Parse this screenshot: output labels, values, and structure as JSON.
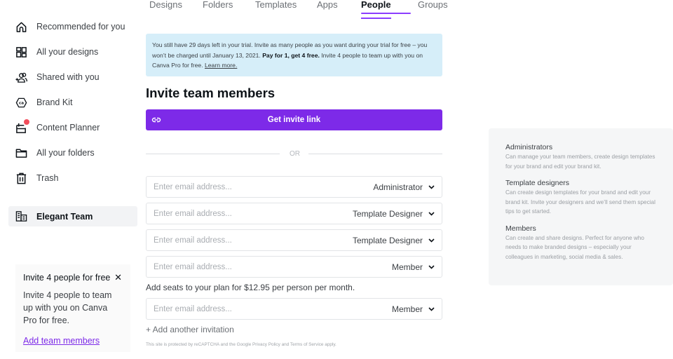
{
  "tabs": [
    {
      "label": "Designs",
      "active": false
    },
    {
      "label": "Folders",
      "active": false
    },
    {
      "label": "Templates",
      "active": false
    },
    {
      "label": "Apps",
      "active": false
    },
    {
      "label": "People",
      "active": true
    },
    {
      "label": "Groups",
      "active": false
    }
  ],
  "sidebar": {
    "items": [
      {
        "label": "Recommended for you",
        "icon": "home-icon"
      },
      {
        "label": "All your designs",
        "icon": "grid-icon"
      },
      {
        "label": "Shared with you",
        "icon": "shared-users-icon"
      },
      {
        "label": "Brand Kit",
        "icon": "brand-kit-icon"
      },
      {
        "label": "Content Planner",
        "icon": "calendar-icon",
        "notification": true
      },
      {
        "label": "All your folders",
        "icon": "folder-icon"
      },
      {
        "label": "Trash",
        "icon": "trash-icon"
      }
    ],
    "team": {
      "label": "Elegant Team",
      "icon": "team-building-icon"
    },
    "promo": {
      "title": "Invite 4 people for free",
      "close_icon": "close-icon",
      "body": "Invite 4 people to team up with you on Canva Pro for free.",
      "link": "Add team members"
    }
  },
  "trial_banner": {
    "text_before": "You still have 29 days left in your trial. Invite as many people as you want during your trial for free – you won’t be charged until January 13, 2021. ",
    "bold": "Pay for 1, get 4 free.",
    "text_after": " Invite 4 people to team up with you on Canva Pro for free. ",
    "link": "Learn more."
  },
  "invite": {
    "heading": "Invite team members",
    "invite_link_button": "Get invite link",
    "or_label": "OR",
    "email_placeholder": "Enter email address...",
    "rows": [
      {
        "value": "",
        "role": "Administrator"
      },
      {
        "value": "",
        "role": "Template Designer"
      },
      {
        "value": "",
        "role": "Template Designer"
      },
      {
        "value": "",
        "role": "Member"
      }
    ],
    "seats_text": "Add seats to your plan for $12.95 per person per month.",
    "extra_rows": [
      {
        "value": "",
        "role": "Member"
      }
    ],
    "add_another": "+ Add another invitation",
    "recaptcha": "This site is protected by reCAPTCHA and the Google Privacy Policy and Terms of Service apply."
  },
  "roles_info": [
    {
      "title": "Administrators",
      "desc": "Can manage your team members, create design templates for your brand and edit your brand kit."
    },
    {
      "title": "Template designers",
      "desc": "Can create design templates for your brand and edit your brand kit. Invite your designers and we’ll send them special tips to get started."
    },
    {
      "title": "Members",
      "desc": "Can create and share designs. Perfect for anyone who needs to make branded designs – especially your colleagues in marketing, social media & sales."
    }
  ],
  "colors": {
    "accent": "#7d2ae8",
    "tab_underline": "#8b3dff",
    "trial_banner_bg": "#d6eef9",
    "notification_dot": "#f24e5b"
  }
}
